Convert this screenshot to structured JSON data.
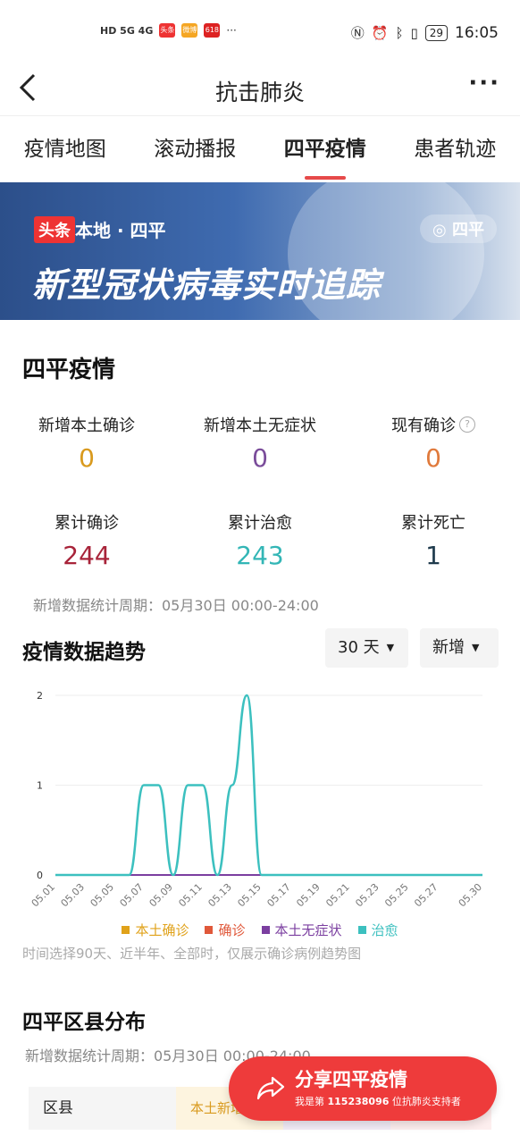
{
  "status_bar": {
    "time": "16:05",
    "battery": "29",
    "signal_left": "HD 5G 4G",
    "notif_badges": [
      "头条",
      "微博",
      "618"
    ]
  },
  "header": {
    "title": "抗击肺炎",
    "back_icon": "chevron-left-icon",
    "more_icon": "more-dots-icon"
  },
  "tabs": [
    {
      "label": "疫情地图",
      "active": false
    },
    {
      "label": "滚动播报",
      "active": false
    },
    {
      "label": "四平疫情",
      "active": true
    },
    {
      "label": "患者轨迹",
      "active": false
    }
  ],
  "banner": {
    "badge": "头条",
    "local": "本地 · 四平",
    "location": "四平",
    "headline": "新型冠状病毒实时追踪"
  },
  "overview": {
    "title": "四平疫情",
    "row1": [
      {
        "label": "新增本土确诊",
        "value": "0",
        "color": "#d99a1e"
      },
      {
        "label": "新增本土无症状",
        "value": "0",
        "color": "#7a4c9a"
      },
      {
        "label": "现有确诊",
        "value": "0",
        "color": "#e07a3c",
        "help": true
      }
    ],
    "row2": [
      {
        "label": "累计确诊",
        "value": "244",
        "color": "#a8243a"
      },
      {
        "label": "累计治愈",
        "value": "243",
        "color": "#33b6b6"
      },
      {
        "label": "累计死亡",
        "value": "1",
        "color": "#1f3b4d"
      }
    ],
    "period_note": "新增数据统计周期：05月30日 00:00-24:00"
  },
  "trend": {
    "title": "疫情数据趋势",
    "range_select": "30 天",
    "type_select": "新增",
    "footnote": "时间选择90天、近半年、全部时，仅展示确诊病例趋势图"
  },
  "chart_data": {
    "type": "line",
    "x": [
      "05.01",
      "05.02",
      "05.03",
      "05.04",
      "05.05",
      "05.06",
      "05.07",
      "05.08",
      "05.09",
      "05.10",
      "05.11",
      "05.12",
      "05.13",
      "05.14",
      "05.15",
      "05.16",
      "05.17",
      "05.18",
      "05.19",
      "05.20",
      "05.21",
      "05.22",
      "05.23",
      "05.24",
      "05.25",
      "05.26",
      "05.27",
      "05.28",
      "05.29",
      "05.30"
    ],
    "x_tick_labels": [
      "05.01",
      "05.03",
      "05.05",
      "05.07",
      "05.09",
      "05.11",
      "05.13",
      "05.15",
      "05.17",
      "05.19",
      "05.21",
      "05.23",
      "05.25",
      "05.27",
      "05.30"
    ],
    "yticks": [
      0,
      1,
      2
    ],
    "ylim": [
      0,
      2
    ],
    "series": [
      {
        "name": "本土确诊",
        "color": "#e0a21a",
        "values": [
          0,
          0,
          0,
          0,
          0,
          0,
          0,
          0,
          0,
          0,
          0,
          0,
          0,
          0,
          0,
          0,
          0,
          0,
          0,
          0,
          0,
          0,
          0,
          0,
          0,
          0,
          0,
          0,
          0,
          0
        ]
      },
      {
        "name": "确诊",
        "color": "#e0583a",
        "values": [
          0,
          0,
          0,
          0,
          0,
          0,
          0,
          0,
          0,
          0,
          0,
          0,
          0,
          0,
          0,
          0,
          0,
          0,
          0,
          0,
          0,
          0,
          0,
          0,
          0,
          0,
          0,
          0,
          0,
          0
        ]
      },
      {
        "name": "本土无症状",
        "color": "#7b3fa0",
        "values": [
          0,
          0,
          0,
          0,
          0,
          0,
          0,
          0,
          0,
          0,
          0,
          0,
          0,
          0,
          0,
          0,
          0,
          0,
          0,
          0,
          0,
          0,
          0,
          0,
          0,
          0,
          0,
          0,
          0,
          0
        ]
      },
      {
        "name": "治愈",
        "color": "#3cc0bf",
        "values": [
          0,
          0,
          0,
          0,
          0,
          0,
          1,
          1,
          0,
          1,
          1,
          0,
          1,
          2,
          0,
          0,
          0,
          0,
          0,
          0,
          0,
          0,
          0,
          0,
          0,
          0,
          0,
          0,
          0,
          0
        ]
      }
    ],
    "legend": "bottom",
    "grid": true
  },
  "district": {
    "title": "四平区县分布",
    "period_note": "新增数据统计周期：05月30日 00:00-24:00",
    "col_county": "区县",
    "col_local_new": "本土新增"
  },
  "share": {
    "title": "分享四平疫情",
    "prefix": "我是第",
    "number": "115238096",
    "suffix": "位抗肺炎支持者"
  }
}
